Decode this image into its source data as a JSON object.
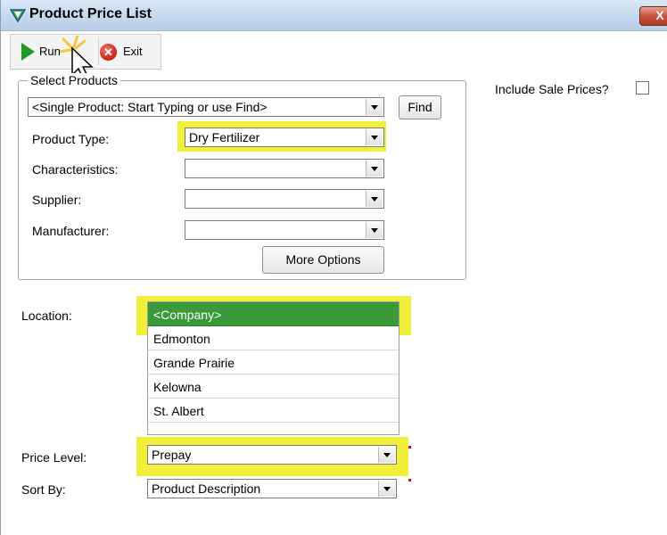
{
  "window": {
    "title": "Product Price List",
    "close_label": "X"
  },
  "toolbar": {
    "run_label": "Run",
    "exit_label": "Exit"
  },
  "select_products": {
    "group_label": "Select Products",
    "product_value": "<Single Product: Start Typing or use Find>",
    "find_label": "Find",
    "product_type_label": "Product Type:",
    "product_type_value": "Dry Fertilizer",
    "characteristics_label": "Characteristics:",
    "characteristics_value": "",
    "supplier_label": "Supplier:",
    "supplier_value": "",
    "manufacturer_label": "Manufacturer:",
    "manufacturer_value": "",
    "more_options_label": "More Options"
  },
  "include_sale_prices": {
    "label": "Include Sale Prices?",
    "checked": false
  },
  "location": {
    "label": "Location:",
    "items": [
      "<Company>",
      "Edmonton",
      "Grande Prairie",
      "Kelowna",
      "St. Albert"
    ],
    "selected_index": 0
  },
  "price_level": {
    "label": "Price Level:",
    "value": "Prepay"
  },
  "sort_by": {
    "label": "Sort By:",
    "value": "Product Description"
  },
  "colors": {
    "highlight": "#f2ef3a",
    "selection": "#3a9a3a",
    "title_bar": "#c4d8ee"
  }
}
